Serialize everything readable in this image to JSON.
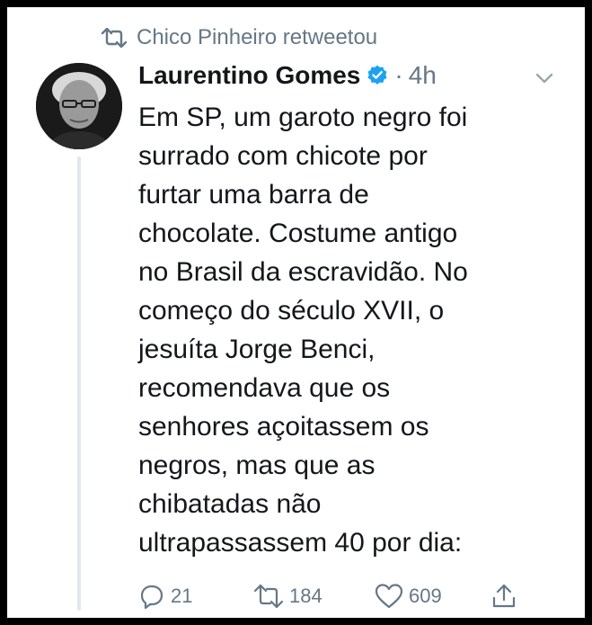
{
  "retweet_context": {
    "icon": "retweet-icon",
    "text": "Chico Pinheiro retweetou"
  },
  "tweet": {
    "author_name": "Laurentino Gomes",
    "verified": true,
    "separator": "·",
    "time": "4h",
    "text": "Em SP, um garoto negro foi\nsurrado com chicote por\nfurtar uma barra de\nchocolate. Costume antigo\nno Brasil da escravidão. No\ncomeço do século XVII, o\njesuíta Jorge Benci,\nrecomendava que os\nsenhores açoitassem os\nnegros, mas que as\nchibatadas não\nultrapassassem 40 por dia:"
  },
  "actions": {
    "reply_count": "21",
    "retweet_count": "184",
    "like_count": "609"
  },
  "colors": {
    "text": "#14171a",
    "secondary": "#657786",
    "verified": "#1da1f2",
    "thread_line": "#e1e8ed"
  }
}
